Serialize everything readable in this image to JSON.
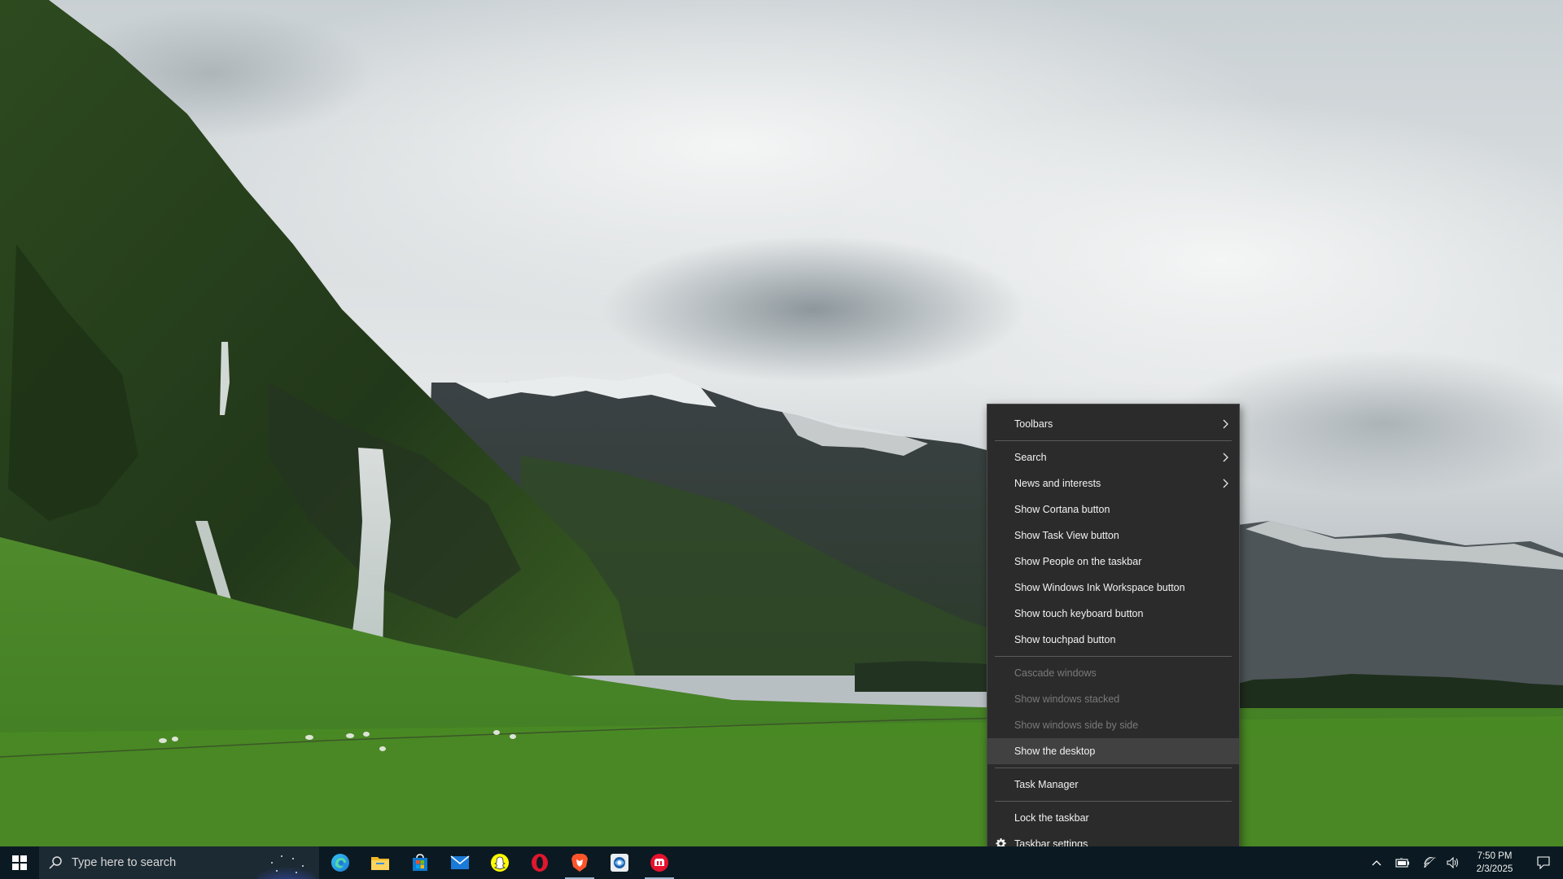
{
  "menu": {
    "items": [
      {
        "label": "Toolbars",
        "submenu": true,
        "disabled": false,
        "hover": false,
        "sep_after": true
      },
      {
        "label": "Search",
        "submenu": true,
        "disabled": false,
        "hover": false,
        "sep_after": false
      },
      {
        "label": "News and interests",
        "submenu": true,
        "disabled": false,
        "hover": false,
        "sep_after": false
      },
      {
        "label": "Show Cortana button",
        "submenu": false,
        "disabled": false,
        "hover": false,
        "sep_after": false
      },
      {
        "label": "Show Task View button",
        "submenu": false,
        "disabled": false,
        "hover": false,
        "sep_after": false
      },
      {
        "label": "Show People on the taskbar",
        "submenu": false,
        "disabled": false,
        "hover": false,
        "sep_after": false
      },
      {
        "label": "Show Windows Ink Workspace button",
        "submenu": false,
        "disabled": false,
        "hover": false,
        "sep_after": false
      },
      {
        "label": "Show touch keyboard button",
        "submenu": false,
        "disabled": false,
        "hover": false,
        "sep_after": false
      },
      {
        "label": "Show touchpad button",
        "submenu": false,
        "disabled": false,
        "hover": false,
        "sep_after": true
      },
      {
        "label": "Cascade windows",
        "submenu": false,
        "disabled": true,
        "hover": false,
        "sep_after": false
      },
      {
        "label": "Show windows stacked",
        "submenu": false,
        "disabled": true,
        "hover": false,
        "sep_after": false
      },
      {
        "label": "Show windows side by side",
        "submenu": false,
        "disabled": true,
        "hover": false,
        "sep_after": false
      },
      {
        "label": "Show the desktop",
        "submenu": false,
        "disabled": false,
        "hover": true,
        "sep_after": true
      },
      {
        "label": "Task Manager",
        "submenu": false,
        "disabled": false,
        "hover": false,
        "sep_after": true
      },
      {
        "label": "Lock the taskbar",
        "submenu": false,
        "disabled": false,
        "hover": false,
        "sep_after": false
      },
      {
        "label": "Taskbar settings",
        "submenu": false,
        "disabled": false,
        "hover": false,
        "sep_after": false,
        "icon": "gear-icon"
      }
    ]
  },
  "taskbar": {
    "search_placeholder": "Type here to search",
    "pinned_apps": [
      {
        "name": "edge-icon",
        "active": false
      },
      {
        "name": "file-explorer-icon",
        "active": false
      },
      {
        "name": "microsoft-store-icon",
        "active": false
      },
      {
        "name": "mail-icon",
        "active": false
      },
      {
        "name": "snapchat-icon",
        "active": false
      },
      {
        "name": "opera-icon",
        "active": false
      },
      {
        "name": "brave-icon",
        "active": true
      },
      {
        "name": "app-icon",
        "active": false
      },
      {
        "name": "red-app-icon",
        "active": true
      }
    ],
    "tray_icons": [
      "chevron-up-icon",
      "battery-icon",
      "wifi-icon",
      "volume-icon"
    ],
    "clock": {
      "time": "7:50 PM",
      "date": "2/3/2025"
    }
  },
  "colors": {
    "menu_bg": "#2b2b2b",
    "menu_hover": "#414141",
    "menu_text": "#f2f2f2",
    "menu_disabled": "#7a7a7a",
    "taskbar_bg": "#0b1a22"
  }
}
